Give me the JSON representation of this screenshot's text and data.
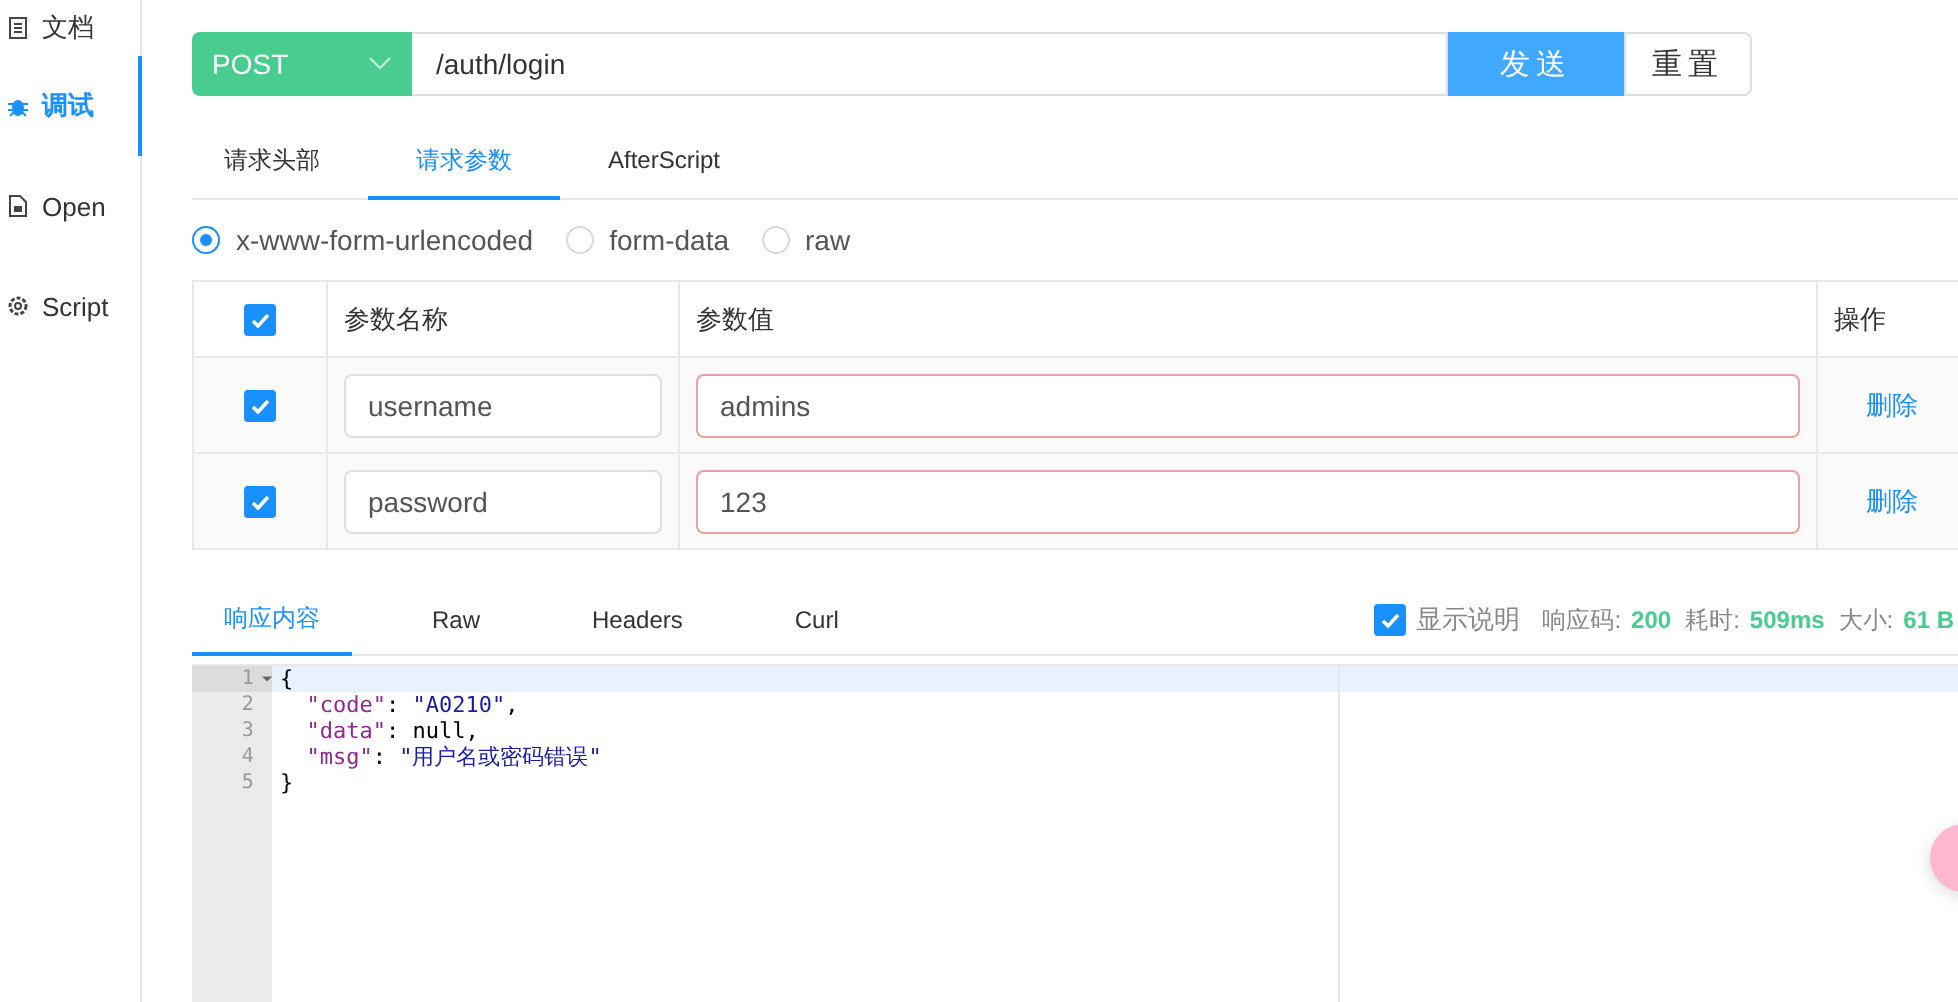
{
  "sidebar": {
    "items": [
      {
        "label": "文档",
        "selected": false
      },
      {
        "label": "调试",
        "selected": true
      },
      {
        "label": "Open",
        "selected": false
      },
      {
        "label": "Script",
        "selected": false
      }
    ]
  },
  "request": {
    "method": "POST",
    "url": "/auth/login",
    "buttons": [
      {
        "label": "发送",
        "kind": "primary"
      },
      {
        "label": "重置",
        "kind": "default"
      }
    ]
  },
  "request_tabs": [
    {
      "label": "请求头部",
      "selected": false
    },
    {
      "label": "请求参数",
      "selected": true
    },
    {
      "label": "AfterScript",
      "selected": false
    }
  ],
  "body_types": [
    {
      "label": "x-www-form-urlencoded",
      "selected": true
    },
    {
      "label": "form-data",
      "selected": false
    },
    {
      "label": "raw",
      "selected": false
    }
  ],
  "params": {
    "all_checked": true,
    "columns": [
      "参数名称",
      "参数值",
      "操作"
    ],
    "rows": [
      {
        "checked": true,
        "name": "username",
        "value": "admins",
        "action": "删除"
      },
      {
        "checked": true,
        "name": "password",
        "value": "123",
        "action": "删除"
      }
    ]
  },
  "response_tabs": [
    {
      "label": "响应内容",
      "selected": true
    },
    {
      "label": "Raw",
      "selected": false
    },
    {
      "label": "Headers",
      "selected": false
    },
    {
      "label": "Curl",
      "selected": false
    }
  ],
  "response_info": {
    "show_description": {
      "label": "显示说明",
      "checked": true
    },
    "stats": [
      {
        "label": "响应码:",
        "value": "200"
      },
      {
        "label": "耗时:",
        "value": "509ms"
      },
      {
        "label": "大小:",
        "value": "61 B"
      }
    ]
  },
  "editor": {
    "lines": [
      {
        "number": "1",
        "fold": true,
        "active": true,
        "tokens": [
          {
            "kind": "punct",
            "text": "{"
          }
        ]
      },
      {
        "number": "2",
        "fold": false,
        "active": false,
        "tokens": [
          {
            "kind": "key",
            "text": "  \"code\""
          },
          {
            "kind": "punct",
            "text": ": "
          },
          {
            "kind": "string",
            "text": "\"A0210\""
          },
          {
            "kind": "punct",
            "text": ","
          }
        ]
      },
      {
        "number": "3",
        "fold": false,
        "active": false,
        "tokens": [
          {
            "kind": "key",
            "text": "  \"data\""
          },
          {
            "kind": "punct",
            "text": ": null,"
          }
        ]
      },
      {
        "number": "4",
        "fold": false,
        "active": false,
        "tokens": [
          {
            "kind": "key",
            "text": "  \"msg\""
          },
          {
            "kind": "punct",
            "text": ": "
          },
          {
            "kind": "string",
            "text": "\"用户名或密码错误\""
          }
        ]
      },
      {
        "number": "5",
        "fold": false,
        "active": false,
        "tokens": [
          {
            "kind": "punct",
            "text": "}"
          }
        ]
      }
    ]
  }
}
